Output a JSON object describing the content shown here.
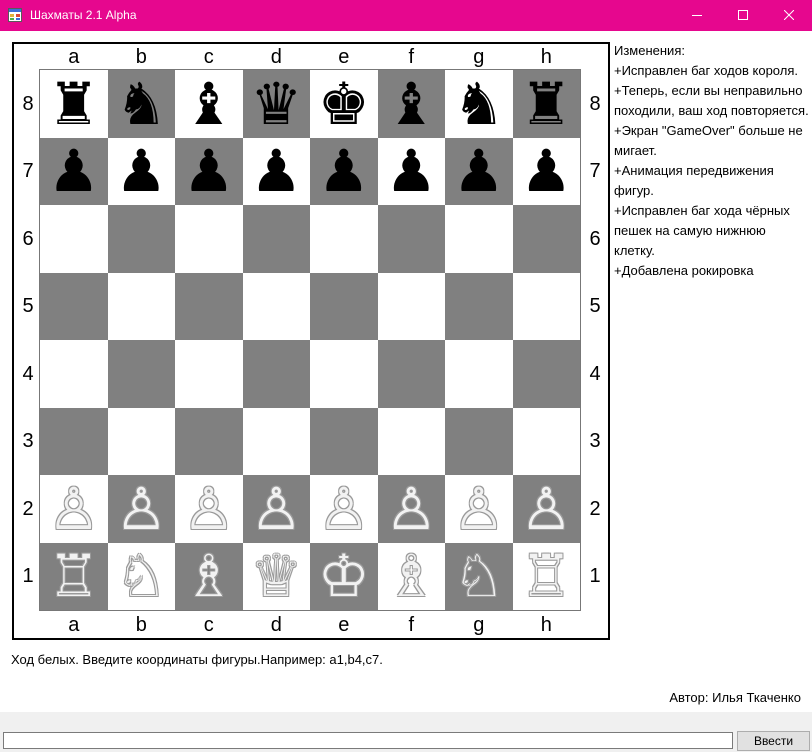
{
  "window": {
    "title": "Шахматы 2.1 Alpha"
  },
  "board": {
    "files": [
      "a",
      "b",
      "c",
      "d",
      "e",
      "f",
      "g",
      "h"
    ],
    "ranks": [
      "8",
      "7",
      "6",
      "5",
      "4",
      "3",
      "2",
      "1"
    ],
    "light_color": "#ffffff",
    "dark_color": "#808080",
    "position": [
      [
        "br",
        "bn",
        "bb",
        "bq",
        "bk",
        "bb",
        "bn",
        "br"
      ],
      [
        "bp",
        "bp",
        "bp",
        "bp",
        "bp",
        "bp",
        "bp",
        "bp"
      ],
      [
        "",
        "",
        "",
        "",
        "",
        "",
        "",
        ""
      ],
      [
        "",
        "",
        "",
        "",
        "",
        "",
        "",
        ""
      ],
      [
        "",
        "",
        "",
        "",
        "",
        "",
        "",
        ""
      ],
      [
        "",
        "",
        "",
        "",
        "",
        "",
        "",
        ""
      ],
      [
        "wp",
        "wp",
        "wp",
        "wp",
        "wp",
        "wp",
        "wp",
        "wp"
      ],
      [
        "wr",
        "wn",
        "wb",
        "wq",
        "wk",
        "wb",
        "wn",
        "wr"
      ]
    ]
  },
  "changelog": {
    "lines": [
      "Изменения:",
      "+Исправлен баг ходов короля.",
      "+Теперь, если вы неправильно походили, ваш ход повторяется.",
      "+Экран \"GameOver\" больше не мигает.",
      "+Анимация передвижения фигур.",
      "+Исправлен баг хода чёрных пешек на самую нижнюю клетку.",
      "+Добавлена рокировка"
    ]
  },
  "status": {
    "text": "Ход белых. Введите координаты фигуры.Например: a1,b4,c7."
  },
  "author": {
    "text": "Автор: Илья Ткаченко"
  },
  "input": {
    "value": ""
  },
  "submit": {
    "label": "Ввести"
  },
  "titlebar_color": "#e6078e"
}
